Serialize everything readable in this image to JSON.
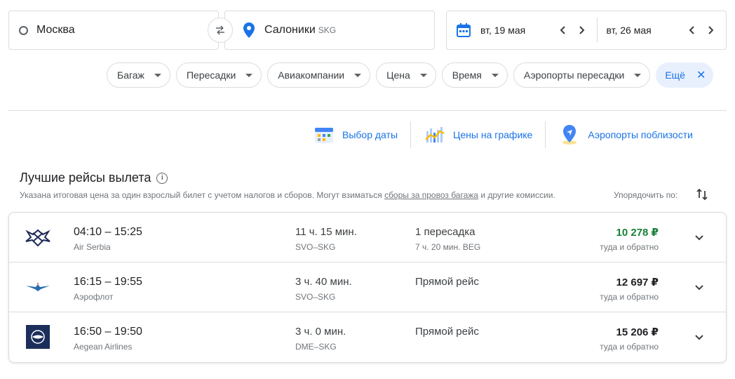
{
  "search": {
    "origin": "Москва",
    "destination": "Салоники",
    "destination_code": "SKG",
    "depart_date": "вт, 19 мая",
    "return_date": "вт, 26 мая"
  },
  "filters": [
    {
      "label": "Багаж"
    },
    {
      "label": "Пересадки"
    },
    {
      "label": "Авиакомпании"
    },
    {
      "label": "Цена"
    },
    {
      "label": "Время"
    },
    {
      "label": "Аэропорты пересадки"
    }
  ],
  "more_filter": "Ещё",
  "tools": {
    "date_picker": "Выбор даты",
    "price_graph": "Цены на графике",
    "nearby_airports": "Аэропорты поблизости"
  },
  "results": {
    "title": "Лучшие рейсы вылета",
    "note_prefix": "Указана итоговая цена за один взрослый билет с учетом налогов и сборов. Могут взиматься ",
    "note_link": "сборы за провоз багажа",
    "note_suffix": " и другие комиссии.",
    "sort_label": "Упорядочить по:",
    "flights": [
      {
        "times": "04:10 – 15:25",
        "airline": "Air Serbia",
        "duration": "11 ч. 15 мин.",
        "route": "SVO–SKG",
        "stops": "1 пересадка",
        "stop_detail": "7 ч. 20 мин. BEG",
        "price": "10 278 ₽",
        "price_type": "туда и обратно"
      },
      {
        "times": "16:15 – 19:55",
        "airline": "Аэрофлот",
        "duration": "3 ч. 40 мин.",
        "route": "SVO–SKG",
        "stops": "Прямой рейс",
        "stop_detail": "",
        "price": "12 697 ₽",
        "price_type": "туда и обратно"
      },
      {
        "times": "16:50 – 19:50",
        "airline": "Aegean Airlines",
        "duration": "3 ч. 0 мин.",
        "route": "DME–SKG",
        "stops": "Прямой рейс",
        "stop_detail": "",
        "price": "15 206 ₽",
        "price_type": "туда и обратно"
      }
    ]
  },
  "colors": {
    "accent": "#1a73e8",
    "best_price": "#188038",
    "border": "#dadce0"
  }
}
